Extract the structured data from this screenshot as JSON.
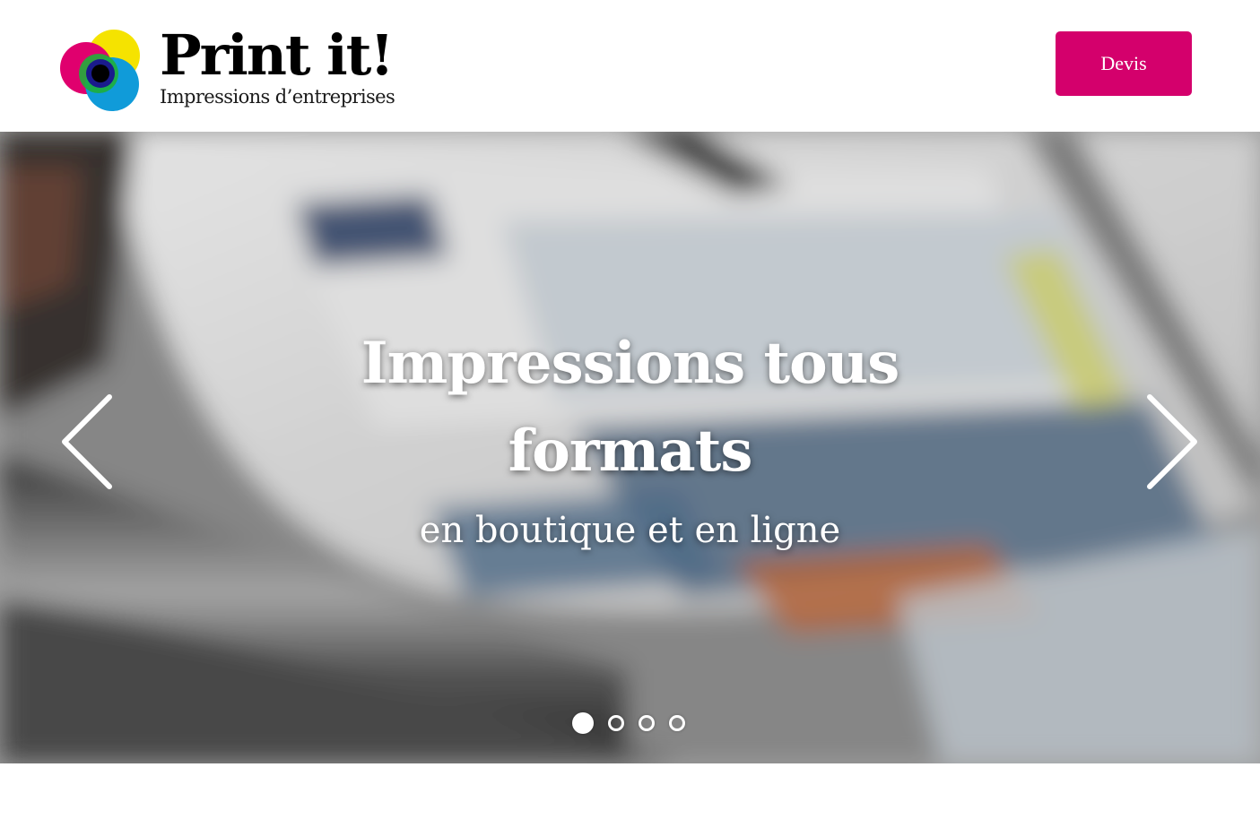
{
  "header": {
    "logo_title": "Print it!",
    "logo_tagline": "Impressions d’entreprises",
    "quote_button_label": "Devis"
  },
  "carousel": {
    "slide_title": "Impressions tous formats",
    "slide_subtitle": "en boutique et en ligne",
    "slide_count": 4,
    "active_slide": 1
  },
  "colors": {
    "accent": "#d4006c",
    "logo_yellow": "#f5e300",
    "logo_magenta": "#e0006e",
    "logo_green": "#1faf3a",
    "logo_blue": "#109bd9",
    "logo_black": "#000000"
  },
  "icons": {
    "logo": "cmyk-circles-logo",
    "prev": "chevron-left-icon",
    "next": "chevron-right-icon"
  }
}
